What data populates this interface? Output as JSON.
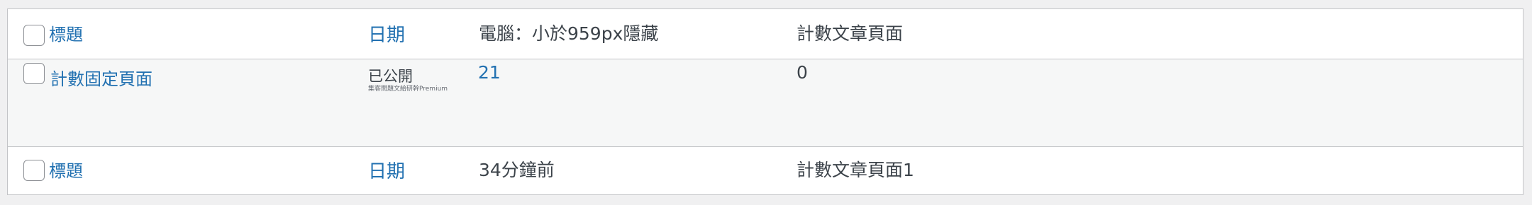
{
  "header": {
    "title_label": "標題",
    "date_label": "日期",
    "col_pc": "電腦：小於959px隱藏",
    "col_count": "計數文章頁面"
  },
  "rows": [
    {
      "title": "計數固定頁面",
      "status": "已公開",
      "status_note": "集客問題文給研幹Premium",
      "pc_value": "21",
      "count_value": "0"
    }
  ],
  "footer": {
    "title_label": "標題",
    "date_label": "日期",
    "col_pc": "34分鐘前",
    "col_count": "計數文章頁面1"
  },
  "colors": {
    "link": "#2271b1",
    "text": "#3c434a",
    "border": "#c3c4c7",
    "alt_row": "#f6f7f7"
  }
}
